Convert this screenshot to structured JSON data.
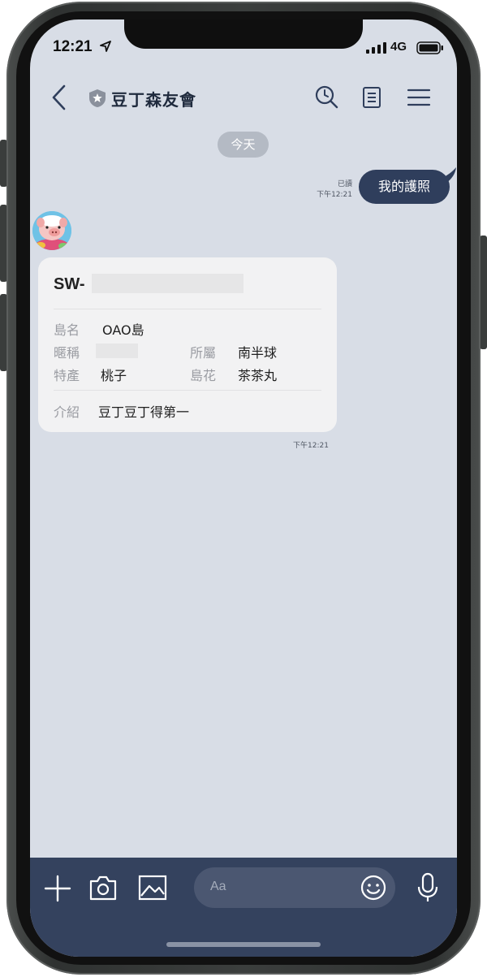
{
  "status_bar": {
    "time": "12:21",
    "network": "4G"
  },
  "header": {
    "title": "豆丁森友會"
  },
  "chat": {
    "date_label": "今天",
    "outgoing": {
      "text": "我的護照",
      "read_label": "已讀",
      "time": "下午12:21"
    },
    "card": {
      "id_prefix": "SW-",
      "island_label": "島名",
      "island_value": "OAO島",
      "nickname_label": "暱稱",
      "hemisphere_label": "所屬",
      "hemisphere_value": "南半球",
      "fruit_label": "特產",
      "fruit_value": "桃子",
      "flower_label": "島花",
      "flower_value": "茶茶丸",
      "intro_label": "介紹",
      "intro_value": "豆丁豆丁得第一",
      "time": "下午12:21"
    }
  },
  "input": {
    "placeholder": "Aa"
  },
  "colors": {
    "chat_bg": "#d8dde6",
    "outgoing_bubble": "#2f3e5c",
    "bottom_bar": "#34425e"
  }
}
